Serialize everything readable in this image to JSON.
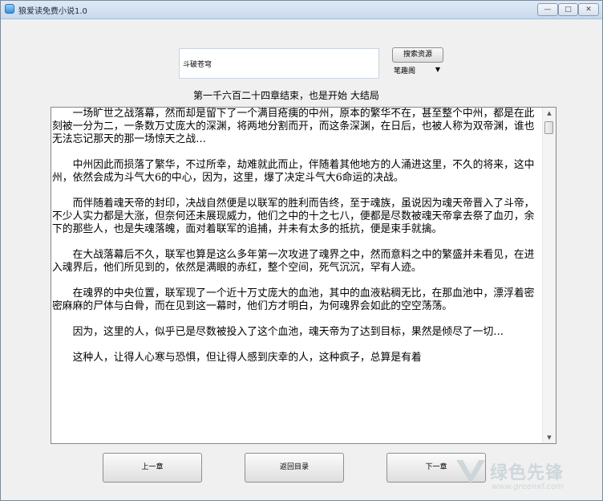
{
  "window": {
    "title": "狼爱读免费小说1.0",
    "controls": {
      "minimize": "—",
      "maximize": "□",
      "close": "✕"
    }
  },
  "search": {
    "query": "斗破苍穹",
    "button_label": "搜索资源",
    "source_selected": "笔趣阁"
  },
  "chapter": {
    "title": "第一千六百二十四章结束，也是开始 大结局",
    "paragraphs": [
      "一场旷世之战落幕，然而却是留下了一个满目疮痍的中州，原本的繁华不在，甚至整个中州，都是在此刻被一分为二，一条数万丈庞大的深渊，将两地分割而开，而这条深渊，在日后，也被人称为双帝渊，谁也无法忘记那天的那一场惊天之战…",
      "中州因此而损落了繁华，不过所幸，劫难就此而止，伴随着其他地方的人涌进这里，不久的将来，这中州，依然会成为斗气大6的中心，因为，这里，爆了决定斗气大6命运的决战。",
      "而伴随着魂天帝的封印，决战自然便是以联军的胜利而告终，至于魂族，虽说因为魂天帝晋入了斗帝，不少人实力都是大涨，但奈何还未展现威力，他们之中的十之七八，便都是尽数被魂天帝拿去祭了血刃，余下的那些人，也是失魂落魄，面对着联军的追捕，并未有太多的抵抗，便是束手就擒。",
      "在大战落幕后不久，联军也算是这么多年第一次攻进了魂界之中，然而意料之中的繁盛并未看见，在进入魂界后，他们所见到的，依然是满眼的赤红，整个空间，死气沉沉，罕有人迹。",
      "在魂界的中央位置，联军现了一个近十万丈庞大的血池，其中的血液粘稠无比，在那血池中，漂浮着密密麻麻的尸体与白骨，而在见到这一幕时，他们方才明白，为何魂界会如此的空空荡荡。",
      "因为，这里的人，似乎已是尽数被投入了这个血池，魂天帝为了达到目标，果然是倾尽了一切…",
      "这种人，让得人心寒与恐惧，但让得人感到庆幸的人，这种疯子，总算是有着"
    ]
  },
  "nav": {
    "prev_label": "上一章",
    "menu_label": "返回目录",
    "next_label": "下一章"
  },
  "watermark": {
    "text": "绿色先锋",
    "url": "www.greenxf.com"
  }
}
